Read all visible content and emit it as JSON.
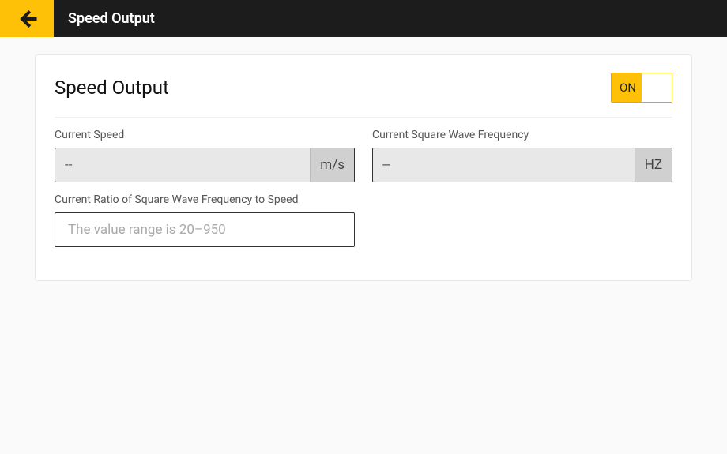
{
  "topbar": {
    "title": "Speed Output"
  },
  "card": {
    "title": "Speed Output",
    "toggle": {
      "label": "ON",
      "state": true
    }
  },
  "fields": {
    "currentSpeed": {
      "label": "Current Speed",
      "value": "--",
      "unit": "m/s"
    },
    "currentFrequency": {
      "label": "Current Square Wave Frequency",
      "value": "--",
      "unit": "HZ"
    },
    "ratio": {
      "label": "Current Ratio of Square Wave Frequency to Speed",
      "value": "",
      "placeholder": "The value range is 20–950"
    }
  }
}
